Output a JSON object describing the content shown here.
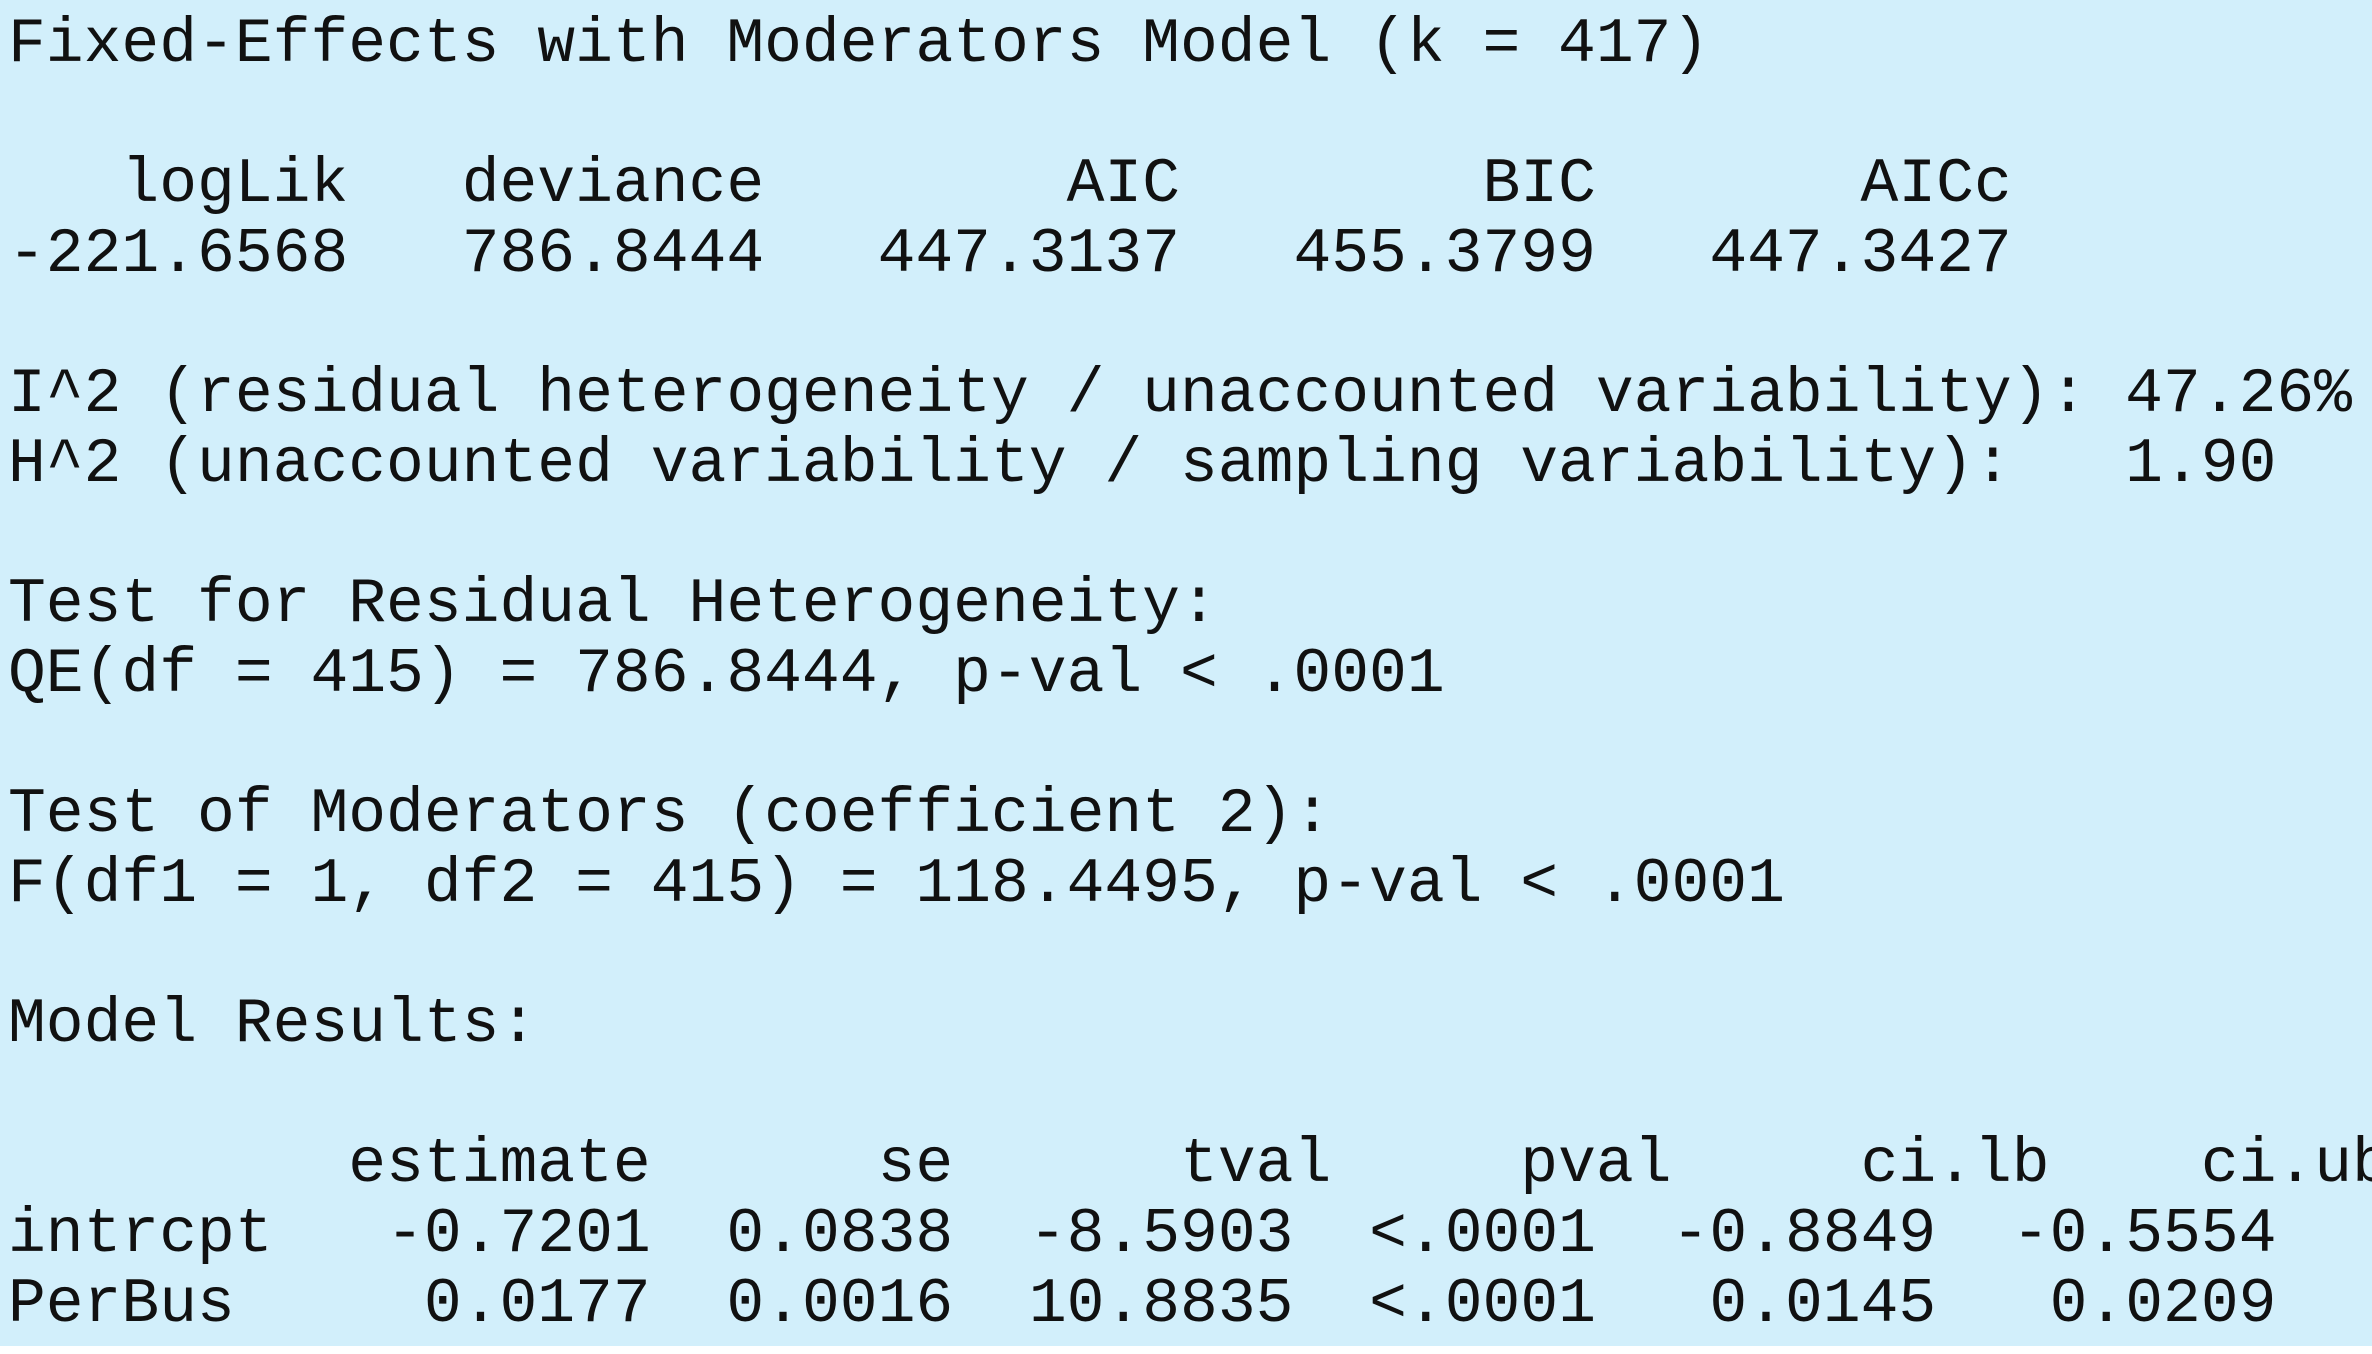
{
  "title": "Fixed-Effects with Moderators Model (k = 417)",
  "fit_stats": {
    "headers": [
      "logLik",
      "deviance",
      "AIC",
      "BIC",
      "AICc"
    ],
    "values": [
      "-221.6568",
      "786.8444",
      "447.3137",
      "455.3799",
      "447.3427"
    ]
  },
  "heterogeneity": {
    "i2_label": "I^2 (residual heterogeneity / unaccounted variability):",
    "i2_value": "47.26%",
    "h2_label": "H^2 (unaccounted variability / sampling variability):",
    "h2_value": "1.90"
  },
  "residual_test": {
    "heading": "Test for Residual Heterogeneity:",
    "result": "QE(df = 415) = 786.8444, p-val < .0001"
  },
  "moderator_test": {
    "heading": "Test of Moderators (coefficient 2):",
    "result": "F(df1 = 1, df2 = 415) = 118.4495, p-val < .0001"
  },
  "model_results": {
    "heading": "Model Results:",
    "columns": [
      "estimate",
      "se",
      "tval",
      "pval",
      "ci.lb",
      "ci.ub"
    ],
    "rows": [
      {
        "name": "intrcpt",
        "estimate": "-0.7201",
        "se": "0.0838",
        "tval": "-8.5903",
        "pval": "<.0001",
        "ci_lb": "-0.8849",
        "ci_ub": "-0.5554"
      },
      {
        "name": "PerBus",
        "estimate": "0.0177",
        "se": "0.0016",
        "tval": "10.8835",
        "pval": "<.0001",
        "ci_lb": "0.0145",
        "ci_ub": "0.0209"
      }
    ]
  },
  "colors": {
    "background": "#d2effb",
    "text": "#111111"
  }
}
